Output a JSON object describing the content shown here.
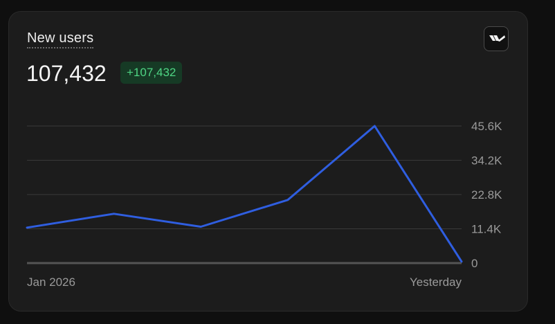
{
  "card": {
    "title": "New users",
    "total": "107,432",
    "change": "+107,432",
    "logo_icon": "brand-logo-icon"
  },
  "colors": {
    "line": "#2f5ee0",
    "badge_bg": "#163a25",
    "badge_text": "#4fd584",
    "grid": "#3a3a3a"
  },
  "chart_data": {
    "type": "line",
    "title": "New users",
    "x_labels": [
      "Jan 2026",
      "Yesterday"
    ],
    "x": [
      0,
      1,
      2,
      3,
      4,
      5
    ],
    "values": [
      11800,
      16400,
      12100,
      21000,
      45600,
      500
    ],
    "ylim": [
      0,
      45600
    ],
    "y_ticks": [
      0,
      11400,
      22800,
      34200,
      45600
    ],
    "y_tick_labels": [
      "0",
      "11.4K",
      "22.8K",
      "34.2K",
      "45.6K"
    ],
    "grid": true,
    "y_axis_position": "right"
  }
}
